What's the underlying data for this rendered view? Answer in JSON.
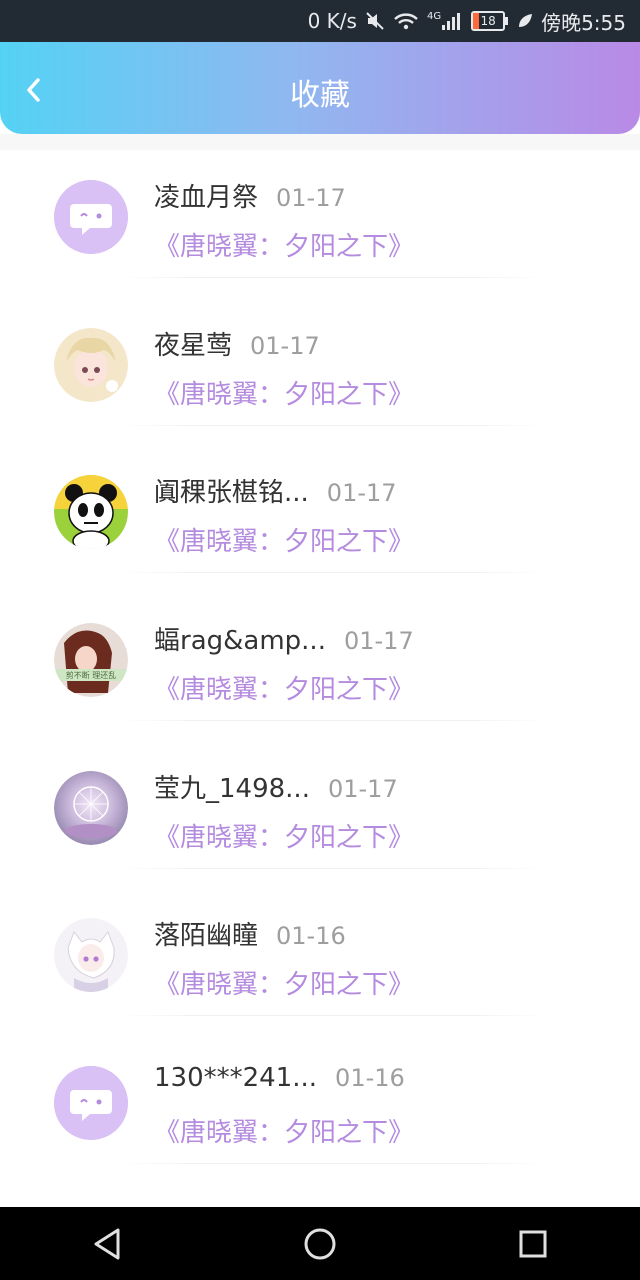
{
  "status_bar": {
    "speed": "0 K/s",
    "network": "4G",
    "battery": "18",
    "time": "傍晚5:55",
    "icons": [
      "mute-icon",
      "wifi-icon",
      "signal-icon",
      "battery-icon",
      "leaf-icon"
    ]
  },
  "header": {
    "title": "收藏",
    "back_icon": "chevron-left-icon",
    "gradient": [
      "#54d2f4",
      "#b98ae6"
    ]
  },
  "items": [
    {
      "name": "凌血月祭",
      "date": "01-17",
      "book": "《唐晓翼：夕阳之下》",
      "avatar": "default-chat-avatar"
    },
    {
      "name": "夜星莺",
      "date": "01-17",
      "book": "《唐晓翼：夕阳之下》",
      "avatar": "anime-girl-avatar"
    },
    {
      "name": "阗稞张椹铭...",
      "date": "01-17",
      "book": "《唐晓翼：夕阳之下》",
      "avatar": "panda-avatar"
    },
    {
      "name": "蝠rag&amp...",
      "date": "01-17",
      "book": "《唐晓翼：夕阳之下》",
      "avatar": "girl-photo-avatar"
    },
    {
      "name": "莹九_1498...",
      "date": "01-17",
      "book": "《唐晓翼：夕阳之下》",
      "avatar": "galaxy-avatar"
    },
    {
      "name": "落陌幽瞳",
      "date": "01-16",
      "book": "《唐晓翼：夕阳之下》",
      "avatar": "white-hair-anime-avatar"
    },
    {
      "name": "130***241...",
      "date": "01-16",
      "book": "《唐晓翼：夕阳之下》",
      "avatar": "default-chat-avatar"
    }
  ],
  "colors": {
    "accent": "#b48bdf",
    "name_text": "#333333",
    "date_text": "#9e9e9e",
    "default_avatar_bg": "#d9c1f6"
  },
  "nav": {
    "buttons": [
      "back-triangle-icon",
      "home-circle-icon",
      "recents-square-icon"
    ]
  }
}
